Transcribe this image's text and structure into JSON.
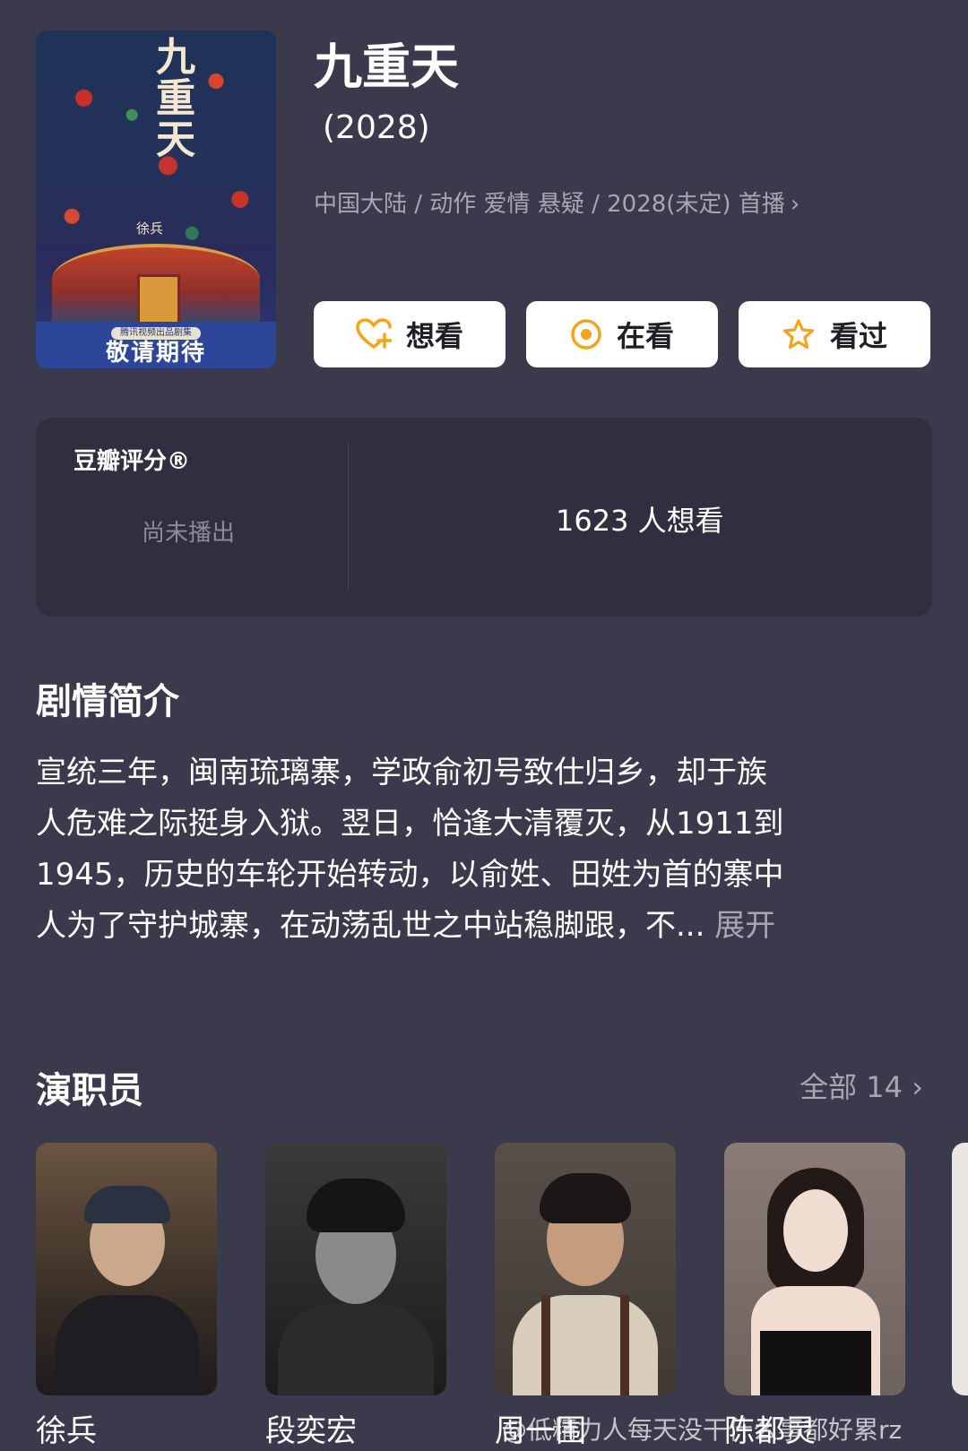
{
  "poster": {
    "title": "九重天",
    "director": "徐兵",
    "producer": "腾讯视频出品剧集",
    "slogan": "敬请期待"
  },
  "show": {
    "title": "九重天",
    "year": "(2028)",
    "meta": "中国大陆 / 动作 爱情 悬疑 / 2028(未定) 首播",
    "chevron": "›"
  },
  "actions": {
    "want": "想看",
    "watching": "在看",
    "watched": "看过"
  },
  "rating": {
    "label": "豆瓣评分®",
    "status": "尚未播出",
    "want_count": "1623 人想看"
  },
  "synopsis": {
    "title": "剧情简介",
    "lines": [
      "宣统三年，闽南琉璃寨，学政俞初号致仕归乡，却于族",
      "人危难之际挺身入狱。翌日，恰逢大清覆灭，从1911到",
      "1945，历史的车轮开始转动，以俞姓、田姓为首的寨中",
      "人为了守护城寨，在动荡乱世之中站稳脚跟，不..."
    ],
    "expand": "展开"
  },
  "cast": {
    "title": "演职员",
    "all_label": "全部 14",
    "chevron": "›",
    "members": [
      {
        "name": "徐兵"
      },
      {
        "name": "段奕宏"
      },
      {
        "name": "周一围"
      },
      {
        "name": "陈都灵"
      }
    ]
  },
  "watermark": "@低精力人每天没干什么事都好累rz"
}
